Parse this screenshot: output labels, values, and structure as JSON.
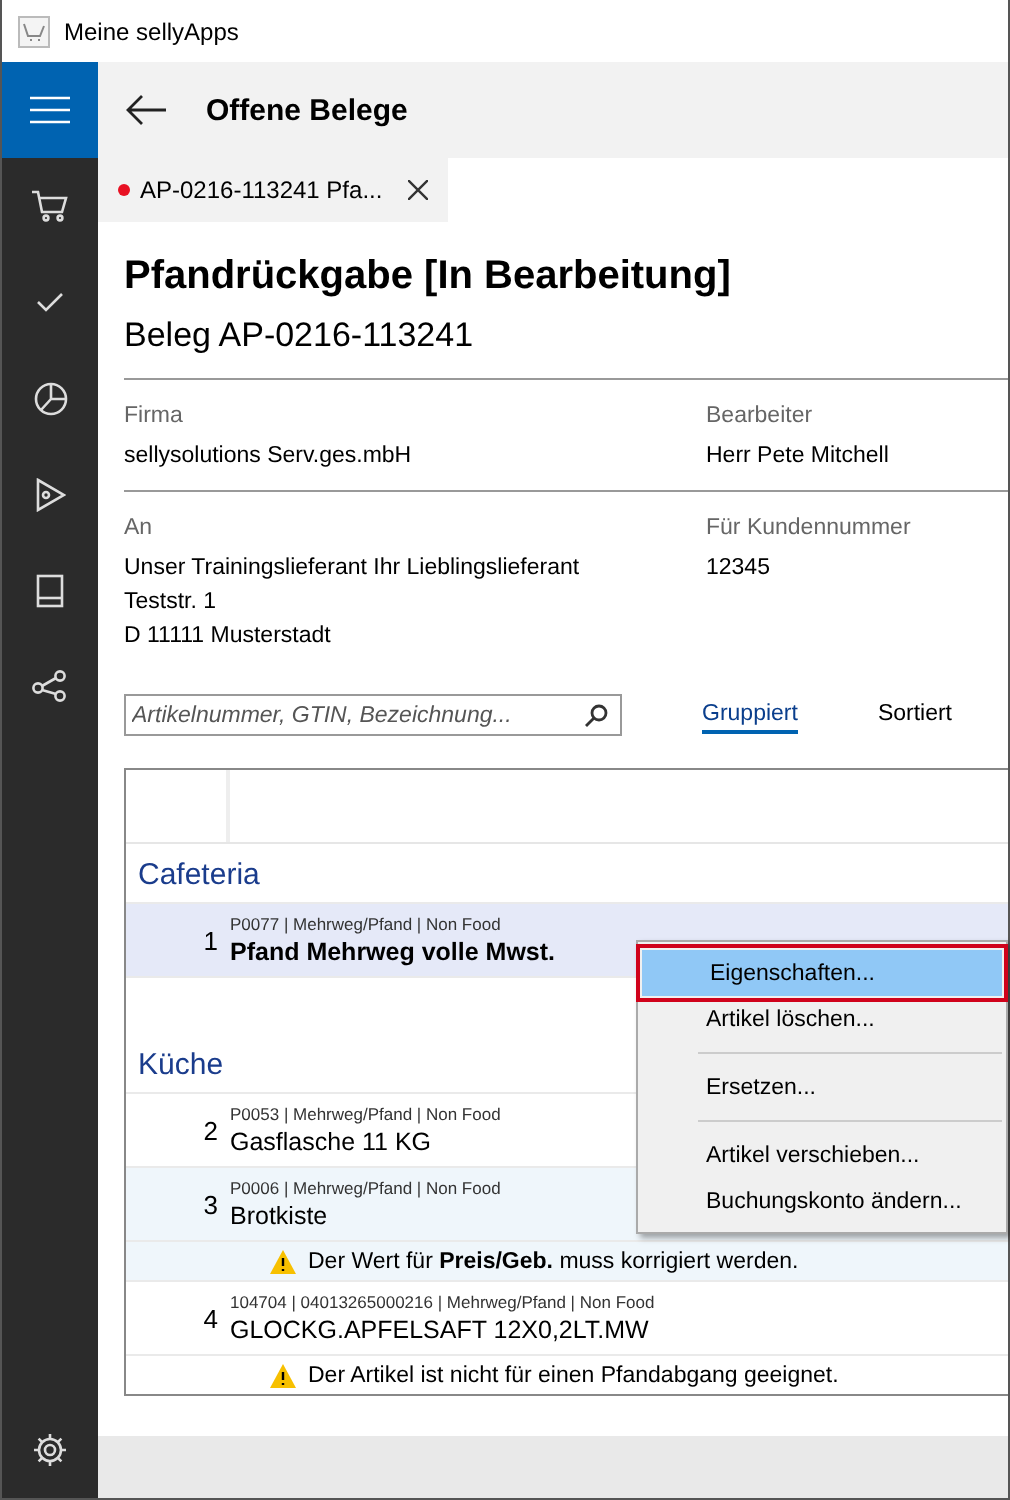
{
  "window": {
    "title": "Meine sellyApps"
  },
  "header": {
    "title": "Offene Belege"
  },
  "tabs": [
    {
      "label": "AP-0216-113241 Pfa...",
      "selected": true,
      "unsaved": true
    }
  ],
  "document": {
    "title": "Pfandrückgabe [In Bearbeitung]",
    "subtitle": "Beleg AP-0216-113241",
    "field_rows": [
      {
        "fields": [
          {
            "label": "Firma",
            "lines": [
              "sellysolutions Serv.ges.mbH"
            ]
          },
          {
            "label": "Bearbeiter",
            "lines": [
              "Herr Pete Mitchell"
            ]
          }
        ]
      },
      {
        "fields": [
          {
            "label": "An",
            "lines": [
              "Unser Trainingslieferant Ihr Lieblingslieferant",
              "Teststr. 1",
              "D 11111 Musterstadt"
            ]
          },
          {
            "label": "Für Kundennummer",
            "lines": [
              "12345"
            ]
          }
        ]
      }
    ]
  },
  "search": {
    "placeholder": "Artikelnummer, GTIN, Bezeichnung..."
  },
  "view_modes": [
    {
      "label": "Gruppiert",
      "selected": true
    },
    {
      "label": "Sortiert",
      "selected": false
    }
  ],
  "groups": [
    {
      "name": "Cafeteria",
      "rows": [
        {
          "number": "1",
          "meta": "P0077 | Mehrweg/Pfand | Non Food",
          "name": "Pfand Mehrweg volle Mwst.",
          "selected": true,
          "hovered": false
        }
      ]
    },
    {
      "name": "Küche",
      "rows": [
        {
          "number": "2",
          "meta": "P0053 | Mehrweg/Pfand | Non Food",
          "name": "Gasflasche 11 KG",
          "selected": false,
          "hovered": false
        },
        {
          "number": "3",
          "meta": "P0006 | Mehrweg/Pfand | Non Food",
          "name": "Brotkiste",
          "selected": false,
          "hovered": true,
          "warning": "Der Wert für **Preis/Geb.** muss korrigiert werden."
        },
        {
          "number": "4",
          "meta": "104704 | 04013265000216 | Mehrweg/Pfand | Non Food",
          "name": "GLOCKG.APFELSAFT 12X0,2LT.MW",
          "selected": false,
          "hovered": false,
          "warning": "Der Artikel ist nicht für einen Pfandabgang geeignet."
        }
      ]
    }
  ],
  "context_menu": {
    "items": [
      {
        "label": "Eigenschaften...",
        "selected": true,
        "divider_before": false
      },
      {
        "label": "Artikel löschen...",
        "selected": false,
        "divider_before": false
      },
      {
        "label": "Ersetzen...",
        "selected": false,
        "divider_before": true
      },
      {
        "label": "Artikel verschieben...",
        "selected": false,
        "divider_before": true
      },
      {
        "label": "Buchungskonto ändern...",
        "selected": false,
        "divider_before": false
      }
    ]
  }
}
